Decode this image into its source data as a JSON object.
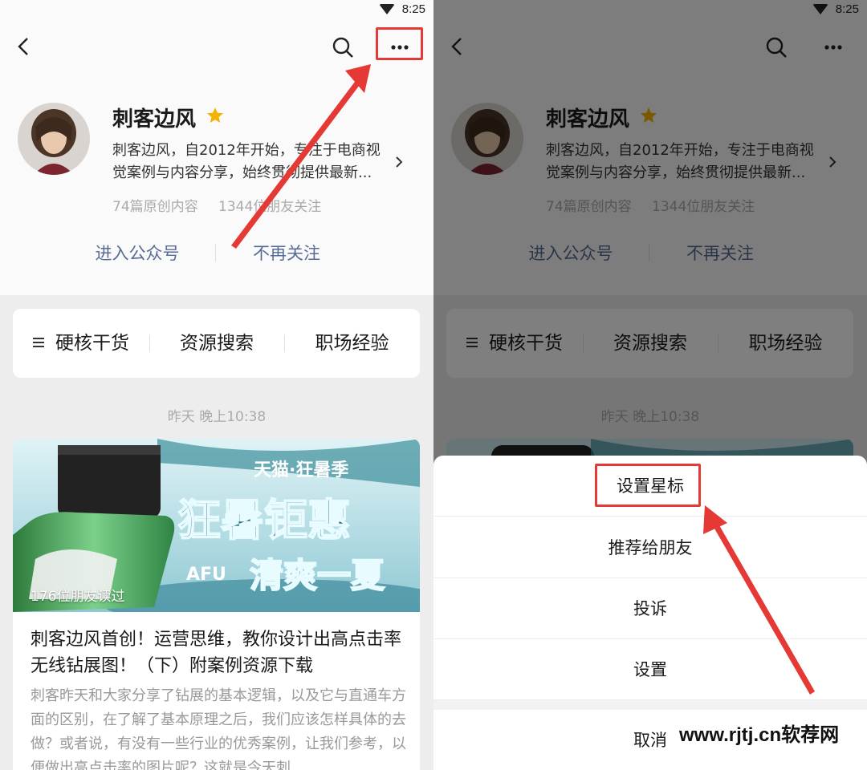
{
  "status": {
    "time": "8:25"
  },
  "account": {
    "name": "刺客边风",
    "description": "刺客边风，自2012年开始，专注于电商视觉案例与内容分享，始终贯彻提供最新...",
    "original_count": "74篇原创内容",
    "followers": "1344位朋友关注",
    "enter_label": "进入公众号",
    "unfollow_label": "不再关注"
  },
  "menu": {
    "items": [
      {
        "label": "硬核干货"
      },
      {
        "label": "资源搜索"
      },
      {
        "label": "职场经验"
      }
    ]
  },
  "feed": {
    "timestamp": "昨天 晚上10:38",
    "article": {
      "read_count": "176位朋友读过",
      "title": "刺客边风首创！运营思维，教你设计出高点击率无线钻展图！（下）附案例资源下载",
      "summary": "刺客昨天和大家分享了钻展的基本逻辑，以及它与直通车方面的区别，在了解了基本原理之后，我们应该怎样具体的去做？或者说，有没有一些行业的优秀案例，让我们参考，以便做出高点击率的图片呢？这就是今天刺",
      "cover_text": {
        "top": "天猫·狂暑季",
        "main": "狂暑钜惠",
        "sub": "清爽一夏",
        "brand": "AFU"
      }
    }
  },
  "action_sheet": {
    "items": [
      {
        "label": "设置星标"
      },
      {
        "label": "推荐给朋友"
      },
      {
        "label": "投诉"
      },
      {
        "label": "设置"
      }
    ],
    "cancel_label": "取消"
  },
  "watermark": "www.rjtj.cn软荐网",
  "colors": {
    "accent_link": "#576b95",
    "annotation_red": "#e53935",
    "star": "#f5b301"
  }
}
